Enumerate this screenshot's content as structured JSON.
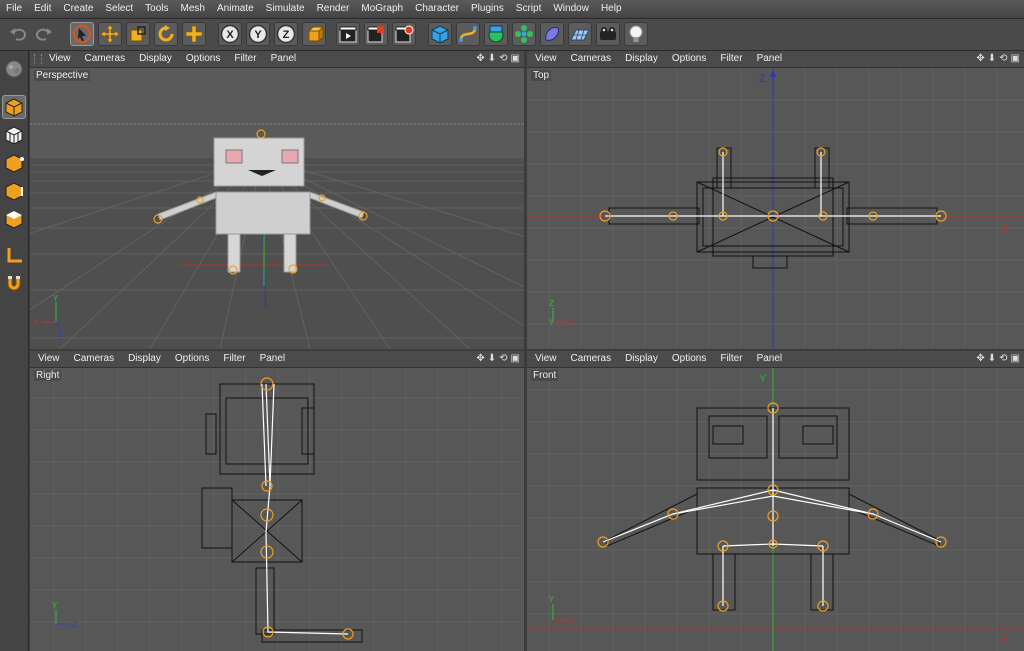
{
  "menubar": {
    "items": [
      "File",
      "Edit",
      "Create",
      "Select",
      "Tools",
      "Mesh",
      "Animate",
      "Simulate",
      "Render",
      "MoGraph",
      "Character",
      "Plugins",
      "Script",
      "Window",
      "Help"
    ]
  },
  "toolbar": {
    "tools": [
      {
        "name": "undo-icon"
      },
      {
        "name": "redo-icon"
      },
      {
        "name": "live-selection-icon"
      },
      {
        "name": "move-icon"
      },
      {
        "name": "scale-icon"
      },
      {
        "name": "rotate-icon"
      },
      {
        "name": "add-icon"
      },
      {
        "name": "x-axis-lock-icon",
        "label": "X"
      },
      {
        "name": "y-axis-lock-icon",
        "label": "Y"
      },
      {
        "name": "z-axis-lock-icon",
        "label": "Z"
      },
      {
        "name": "coordinate-system-icon"
      },
      {
        "name": "render-view-icon"
      },
      {
        "name": "render-picture-viewer-icon"
      },
      {
        "name": "render-settings-icon"
      },
      {
        "name": "cube-primitive-icon"
      },
      {
        "name": "spline-icon"
      },
      {
        "name": "nurbs-icon"
      },
      {
        "name": "array-icon"
      },
      {
        "name": "deformer-icon"
      },
      {
        "name": "floor-icon"
      },
      {
        "name": "camera-icon"
      },
      {
        "name": "light-icon"
      }
    ]
  },
  "sidebar": {
    "tools": [
      "sculpt-icon",
      "model-mode-icon",
      "texture-mode-icon",
      "point-mode-icon",
      "edge-mode-icon",
      "polygon-mode-icon",
      "axis-mode-icon",
      "magnet-icon"
    ]
  },
  "viewport_menu": {
    "view": "View",
    "cameras": "Cameras",
    "display": "Display",
    "options": "Options",
    "filter": "Filter",
    "panel": "Panel"
  },
  "viewports": {
    "perspective": {
      "label": "Perspective"
    },
    "top": {
      "label": "Top",
      "axis_z": "Z",
      "axis_x": "X"
    },
    "right": {
      "label": "Right"
    },
    "front": {
      "label": "Front",
      "axis_y": "Y",
      "axis_x": "X"
    }
  },
  "gizmo": {
    "x": "X",
    "y": "Y",
    "z": "Z"
  },
  "colors": {
    "background": "#575757",
    "joint": "#f0a020",
    "bone": "#ffffff",
    "mesh_wire": "#111111",
    "axis_x": "#c03030",
    "axis_y": "#30c030",
    "axis_z": "#3040c0"
  }
}
